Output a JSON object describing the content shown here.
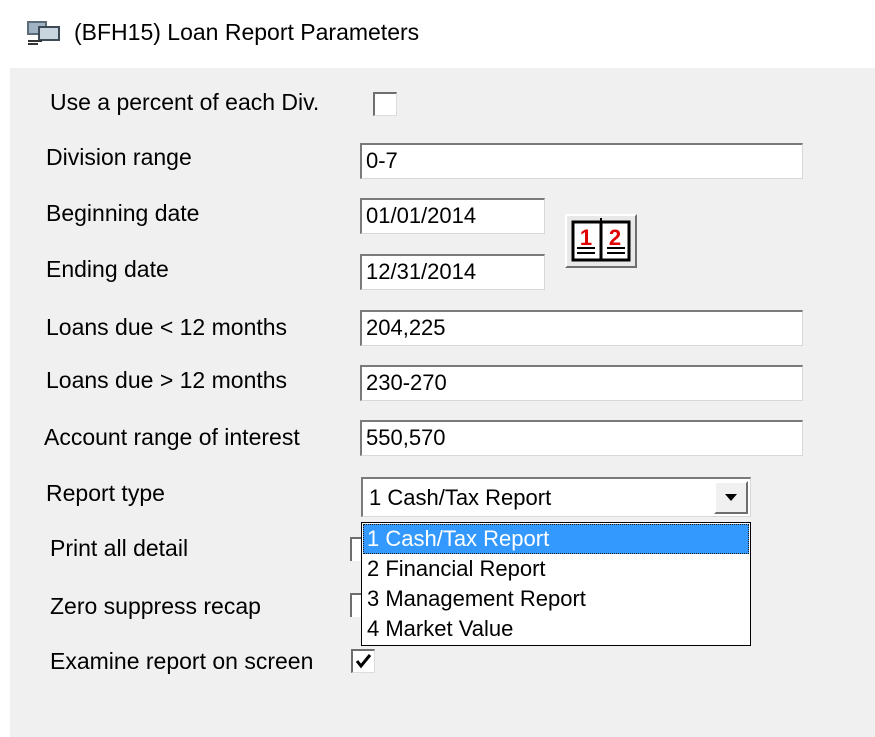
{
  "window": {
    "title": "(BFH15)  Loan Report Parameters",
    "icon": "report-app-icon"
  },
  "form": {
    "use_percent": {
      "label": "Use a percent of each Div.",
      "checked": false
    },
    "division_range": {
      "label": "Division range",
      "value": "0-7"
    },
    "beginning_date": {
      "label": "Beginning date",
      "value": "01/01/2014"
    },
    "ending_date": {
      "label": "Ending date",
      "value": "12/31/2014"
    },
    "calendar_button": {
      "icon": "calendar-icon",
      "glyphs": [
        "1",
        "2"
      ]
    },
    "loans_due_lt": {
      "label": "Loans due < 12 months",
      "value": "204,225"
    },
    "loans_due_gt": {
      "label": "Loans due > 12 months",
      "value": "230-270"
    },
    "account_range": {
      "label": "Account range of interest",
      "value": "550,570"
    },
    "report_type": {
      "label": "Report type",
      "selected": "1  Cash/Tax Report",
      "options": [
        "1  Cash/Tax Report",
        "2  Financial Report",
        "3  Management Report",
        "4  Market Value"
      ],
      "highlighted_index": 0
    },
    "print_all_detail": {
      "label": "Print all detail"
    },
    "zero_suppress": {
      "label": "Zero suppress recap"
    },
    "examine_report": {
      "label": "Examine report on screen",
      "checked": true
    }
  },
  "colors": {
    "panel": "#f0f0f0",
    "highlight": "#3399ff",
    "calendar_red": "#e00000"
  }
}
